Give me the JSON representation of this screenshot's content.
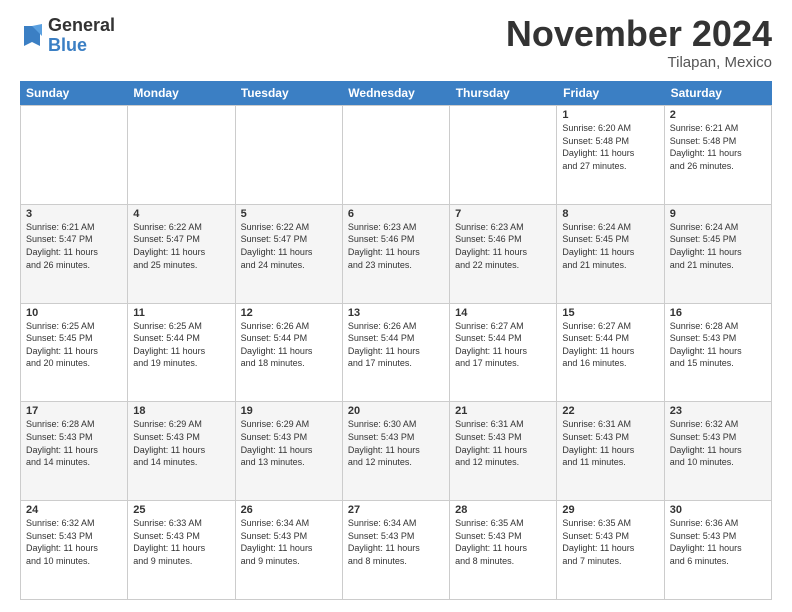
{
  "logo": {
    "general": "General",
    "blue": "Blue"
  },
  "title": "November 2024",
  "location": "Tilapan, Mexico",
  "days": [
    "Sunday",
    "Monday",
    "Tuesday",
    "Wednesday",
    "Thursday",
    "Friday",
    "Saturday"
  ],
  "weeks": [
    [
      {
        "day": "",
        "info": ""
      },
      {
        "day": "",
        "info": ""
      },
      {
        "day": "",
        "info": ""
      },
      {
        "day": "",
        "info": ""
      },
      {
        "day": "",
        "info": ""
      },
      {
        "day": "1",
        "info": "Sunrise: 6:20 AM\nSunset: 5:48 PM\nDaylight: 11 hours\nand 27 minutes."
      },
      {
        "day": "2",
        "info": "Sunrise: 6:21 AM\nSunset: 5:48 PM\nDaylight: 11 hours\nand 26 minutes."
      }
    ],
    [
      {
        "day": "3",
        "info": "Sunrise: 6:21 AM\nSunset: 5:47 PM\nDaylight: 11 hours\nand 26 minutes."
      },
      {
        "day": "4",
        "info": "Sunrise: 6:22 AM\nSunset: 5:47 PM\nDaylight: 11 hours\nand 25 minutes."
      },
      {
        "day": "5",
        "info": "Sunrise: 6:22 AM\nSunset: 5:47 PM\nDaylight: 11 hours\nand 24 minutes."
      },
      {
        "day": "6",
        "info": "Sunrise: 6:23 AM\nSunset: 5:46 PM\nDaylight: 11 hours\nand 23 minutes."
      },
      {
        "day": "7",
        "info": "Sunrise: 6:23 AM\nSunset: 5:46 PM\nDaylight: 11 hours\nand 22 minutes."
      },
      {
        "day": "8",
        "info": "Sunrise: 6:24 AM\nSunset: 5:45 PM\nDaylight: 11 hours\nand 21 minutes."
      },
      {
        "day": "9",
        "info": "Sunrise: 6:24 AM\nSunset: 5:45 PM\nDaylight: 11 hours\nand 21 minutes."
      }
    ],
    [
      {
        "day": "10",
        "info": "Sunrise: 6:25 AM\nSunset: 5:45 PM\nDaylight: 11 hours\nand 20 minutes."
      },
      {
        "day": "11",
        "info": "Sunrise: 6:25 AM\nSunset: 5:44 PM\nDaylight: 11 hours\nand 19 minutes."
      },
      {
        "day": "12",
        "info": "Sunrise: 6:26 AM\nSunset: 5:44 PM\nDaylight: 11 hours\nand 18 minutes."
      },
      {
        "day": "13",
        "info": "Sunrise: 6:26 AM\nSunset: 5:44 PM\nDaylight: 11 hours\nand 17 minutes."
      },
      {
        "day": "14",
        "info": "Sunrise: 6:27 AM\nSunset: 5:44 PM\nDaylight: 11 hours\nand 17 minutes."
      },
      {
        "day": "15",
        "info": "Sunrise: 6:27 AM\nSunset: 5:44 PM\nDaylight: 11 hours\nand 16 minutes."
      },
      {
        "day": "16",
        "info": "Sunrise: 6:28 AM\nSunset: 5:43 PM\nDaylight: 11 hours\nand 15 minutes."
      }
    ],
    [
      {
        "day": "17",
        "info": "Sunrise: 6:28 AM\nSunset: 5:43 PM\nDaylight: 11 hours\nand 14 minutes."
      },
      {
        "day": "18",
        "info": "Sunrise: 6:29 AM\nSunset: 5:43 PM\nDaylight: 11 hours\nand 14 minutes."
      },
      {
        "day": "19",
        "info": "Sunrise: 6:29 AM\nSunset: 5:43 PM\nDaylight: 11 hours\nand 13 minutes."
      },
      {
        "day": "20",
        "info": "Sunrise: 6:30 AM\nSunset: 5:43 PM\nDaylight: 11 hours\nand 12 minutes."
      },
      {
        "day": "21",
        "info": "Sunrise: 6:31 AM\nSunset: 5:43 PM\nDaylight: 11 hours\nand 12 minutes."
      },
      {
        "day": "22",
        "info": "Sunrise: 6:31 AM\nSunset: 5:43 PM\nDaylight: 11 hours\nand 11 minutes."
      },
      {
        "day": "23",
        "info": "Sunrise: 6:32 AM\nSunset: 5:43 PM\nDaylight: 11 hours\nand 10 minutes."
      }
    ],
    [
      {
        "day": "24",
        "info": "Sunrise: 6:32 AM\nSunset: 5:43 PM\nDaylight: 11 hours\nand 10 minutes."
      },
      {
        "day": "25",
        "info": "Sunrise: 6:33 AM\nSunset: 5:43 PM\nDaylight: 11 hours\nand 9 minutes."
      },
      {
        "day": "26",
        "info": "Sunrise: 6:34 AM\nSunset: 5:43 PM\nDaylight: 11 hours\nand 9 minutes."
      },
      {
        "day": "27",
        "info": "Sunrise: 6:34 AM\nSunset: 5:43 PM\nDaylight: 11 hours\nand 8 minutes."
      },
      {
        "day": "28",
        "info": "Sunrise: 6:35 AM\nSunset: 5:43 PM\nDaylight: 11 hours\nand 8 minutes."
      },
      {
        "day": "29",
        "info": "Sunrise: 6:35 AM\nSunset: 5:43 PM\nDaylight: 11 hours\nand 7 minutes."
      },
      {
        "day": "30",
        "info": "Sunrise: 6:36 AM\nSunset: 5:43 PM\nDaylight: 11 hours\nand 6 minutes."
      }
    ]
  ]
}
